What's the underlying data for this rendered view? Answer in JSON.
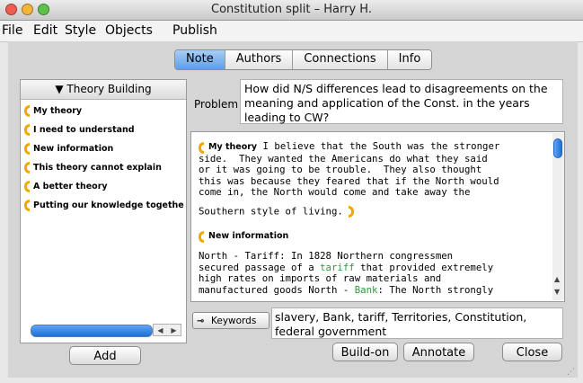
{
  "window": {
    "title": "Constitution split – Harry H.",
    "colors": {
      "close": "#ee5d52",
      "minimize": "#f3b43a",
      "zoom": "#5fc24b",
      "accent": "#f0a800",
      "link_green": "#2a9d3a"
    }
  },
  "menu": [
    "File",
    "Edit",
    "Style",
    "Objects",
    "Publish"
  ],
  "tabs": [
    "Note",
    "Authors",
    "Connections",
    "Info"
  ],
  "sidebar": {
    "header": "▼ Theory Building",
    "items": [
      "My theory",
      "I need to understand",
      "New information",
      "This theory cannot explain",
      "A better theory",
      "Putting our knowledge togethe"
    ],
    "add_label": "Add"
  },
  "problem": {
    "label": "Problem",
    "text": "How did N/S differences lead to disagreements on the meaning and application of the Const. in the years leading to CW?"
  },
  "note": {
    "scaffold1": "My theory",
    "para1_first": "I believe that the South was the stronger",
    "para1_rest": "side.  They wanted the Americans do what they said\nor it was going to be trouble.  They also thought\nthis was because they feared that if the North would\ncome in, the North would come and take away the",
    "para1_end": "Southern style of living.",
    "scaffold2": "New information",
    "para2": {
      "a": "North - Tar",
      "b": "iff: In  1828 Northern congressmen",
      "c": "secured passage of a ",
      "d": "tariff",
      "e": " that provided extremely",
      "f": "high rates on imports of raw materials and",
      "g": "manufactured goods North - ",
      "h": "Bank",
      "i": ": The North strongly"
    }
  },
  "keywords": {
    "button_label": "Keywords",
    "text": "slavery, Bank, tariff, Territories, Constitution, federal government"
  },
  "actions": {
    "build_on": "Build-on",
    "annotate": "Annotate",
    "close": "Close"
  }
}
